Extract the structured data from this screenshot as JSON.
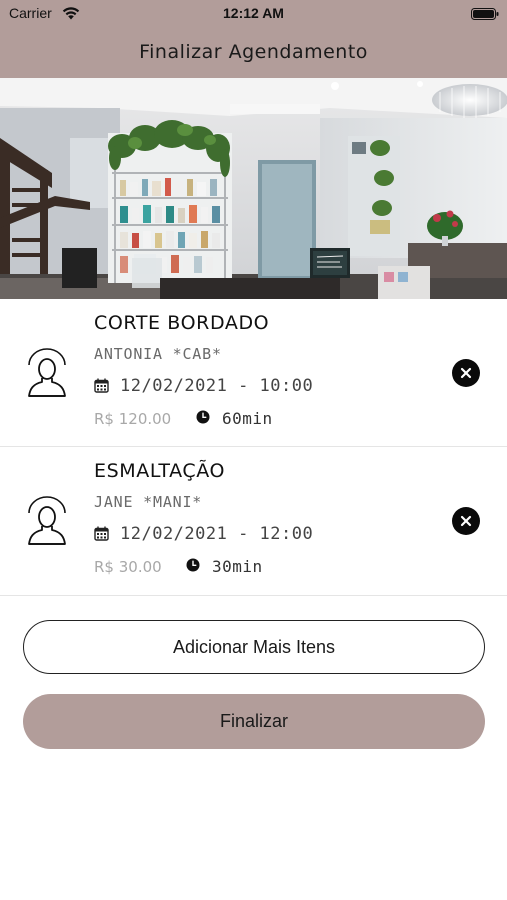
{
  "status_bar": {
    "carrier": "Carrier",
    "time": "12:12 AM"
  },
  "header": {
    "title": "Finalizar Agendamento"
  },
  "colors": {
    "brand": "#b29d9a",
    "remove_button": "#0a0a0a",
    "price_text": "#a8a8a8"
  },
  "hero": {
    "image": "salon-interior-photo"
  },
  "items": [
    {
      "service": "CORTE BORDADO",
      "professional": "ANTONIA *CAB*",
      "datetime": "12/02/2021 - 10:00",
      "price": "R$ 120.00",
      "duration": "60min",
      "icons": {
        "avatar": "person-outline-icon",
        "date": "calendar-icon",
        "duration": "clock-icon",
        "remove": "close-icon"
      }
    },
    {
      "service": "ESMALTAÇÃO",
      "professional": "JANE *MANI*",
      "datetime": "12/02/2021 - 12:00",
      "price": "R$ 30.00",
      "duration": "30min",
      "icons": {
        "avatar": "person-outline-icon",
        "date": "calendar-icon",
        "duration": "clock-icon",
        "remove": "close-icon"
      }
    }
  ],
  "actions": {
    "add_more": "Adicionar Mais Itens",
    "finish": "Finalizar"
  }
}
